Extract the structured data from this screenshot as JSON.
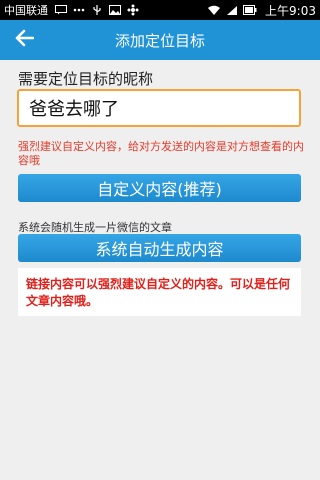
{
  "status_bar": {
    "carrier": "中国联通",
    "time": "上午9:03"
  },
  "header": {
    "title": "添加定位目标",
    "back_icon": "arrow-left-icon"
  },
  "form": {
    "nickname_label": "需要定位目标的昵称",
    "nickname_value": "爸爸去哪了",
    "custom_hint": "强烈建议自定义内容，给对方发送的内容是对方想查看的内容哦",
    "custom_button": "自定义内容(推荐)",
    "auto_hint": "系统会随机生成一片微信的文章",
    "auto_button": "系统自动生成内容",
    "notice": "链接内容可以强烈建议自定义的内容。可以是任何文章内容哦。"
  },
  "colors": {
    "header_bg": "#1f93d6",
    "button_bg": "#1d8acd",
    "input_border": "#f2a33a",
    "hint_red": "#e53a2a"
  }
}
